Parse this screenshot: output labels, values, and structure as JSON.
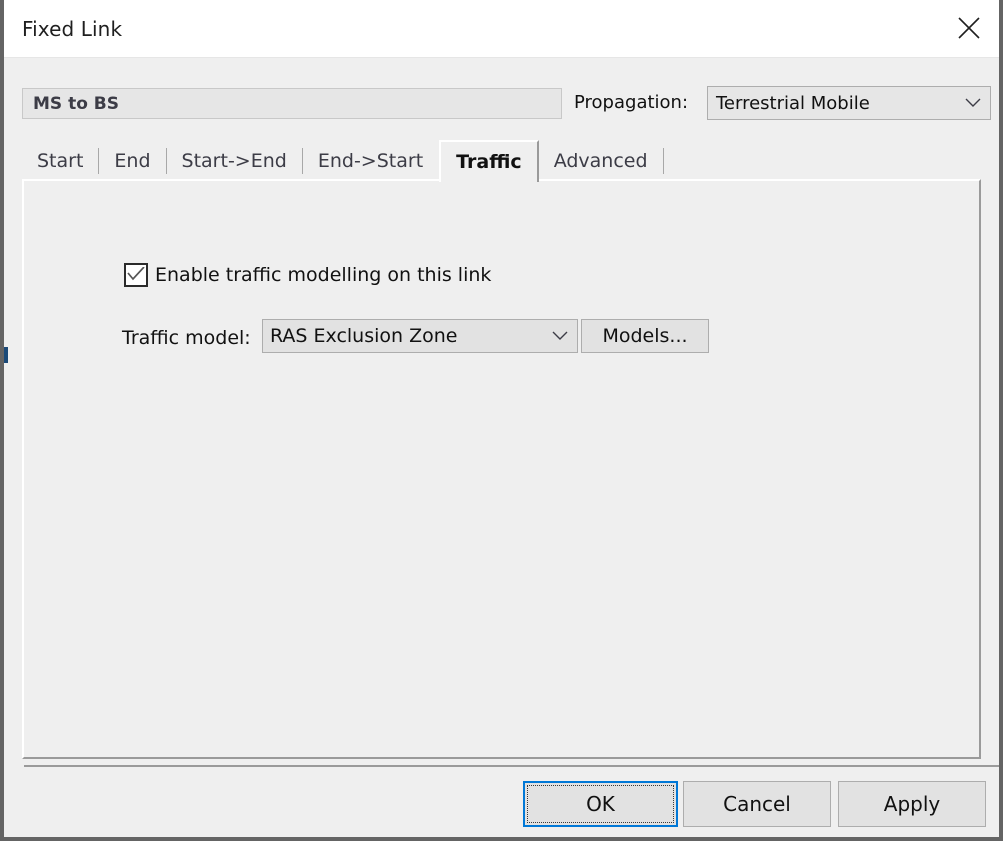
{
  "window": {
    "title": "Fixed Link",
    "close_icon": "close-x-icon"
  },
  "header": {
    "link_name": "MS to BS",
    "propagation_label": "Propagation:",
    "propagation_value": "Terrestrial Mobile",
    "propagation_chevron": "chevron-down-icon"
  },
  "tabs": [
    {
      "label": "Start",
      "active": false
    },
    {
      "label": "End",
      "active": false
    },
    {
      "label": "Start->End",
      "active": false
    },
    {
      "label": "End->Start",
      "active": false
    },
    {
      "label": "Traffic",
      "active": true
    },
    {
      "label": "Advanced",
      "active": false
    }
  ],
  "traffic_tab": {
    "enable_checkbox_label": "Enable traffic modelling on this link",
    "enable_checkbox_checked": "checked",
    "checkmark_icon": "checkmark-icon",
    "traffic_model_label": "Traffic model:",
    "traffic_model_value": "RAS Exclusion Zone",
    "traffic_model_chevron": "chevron-down-icon",
    "models_button_label": "Models..."
  },
  "footer": {
    "ok_label": "OK",
    "cancel_label": "Cancel",
    "apply_label": "Apply"
  },
  "colors": {
    "accent_focus": "#0078d7",
    "window_border": "#646464",
    "dialog_background": "#efefef",
    "titlebar_background": "#ffffff",
    "edge_marker": "#1b4a78"
  }
}
